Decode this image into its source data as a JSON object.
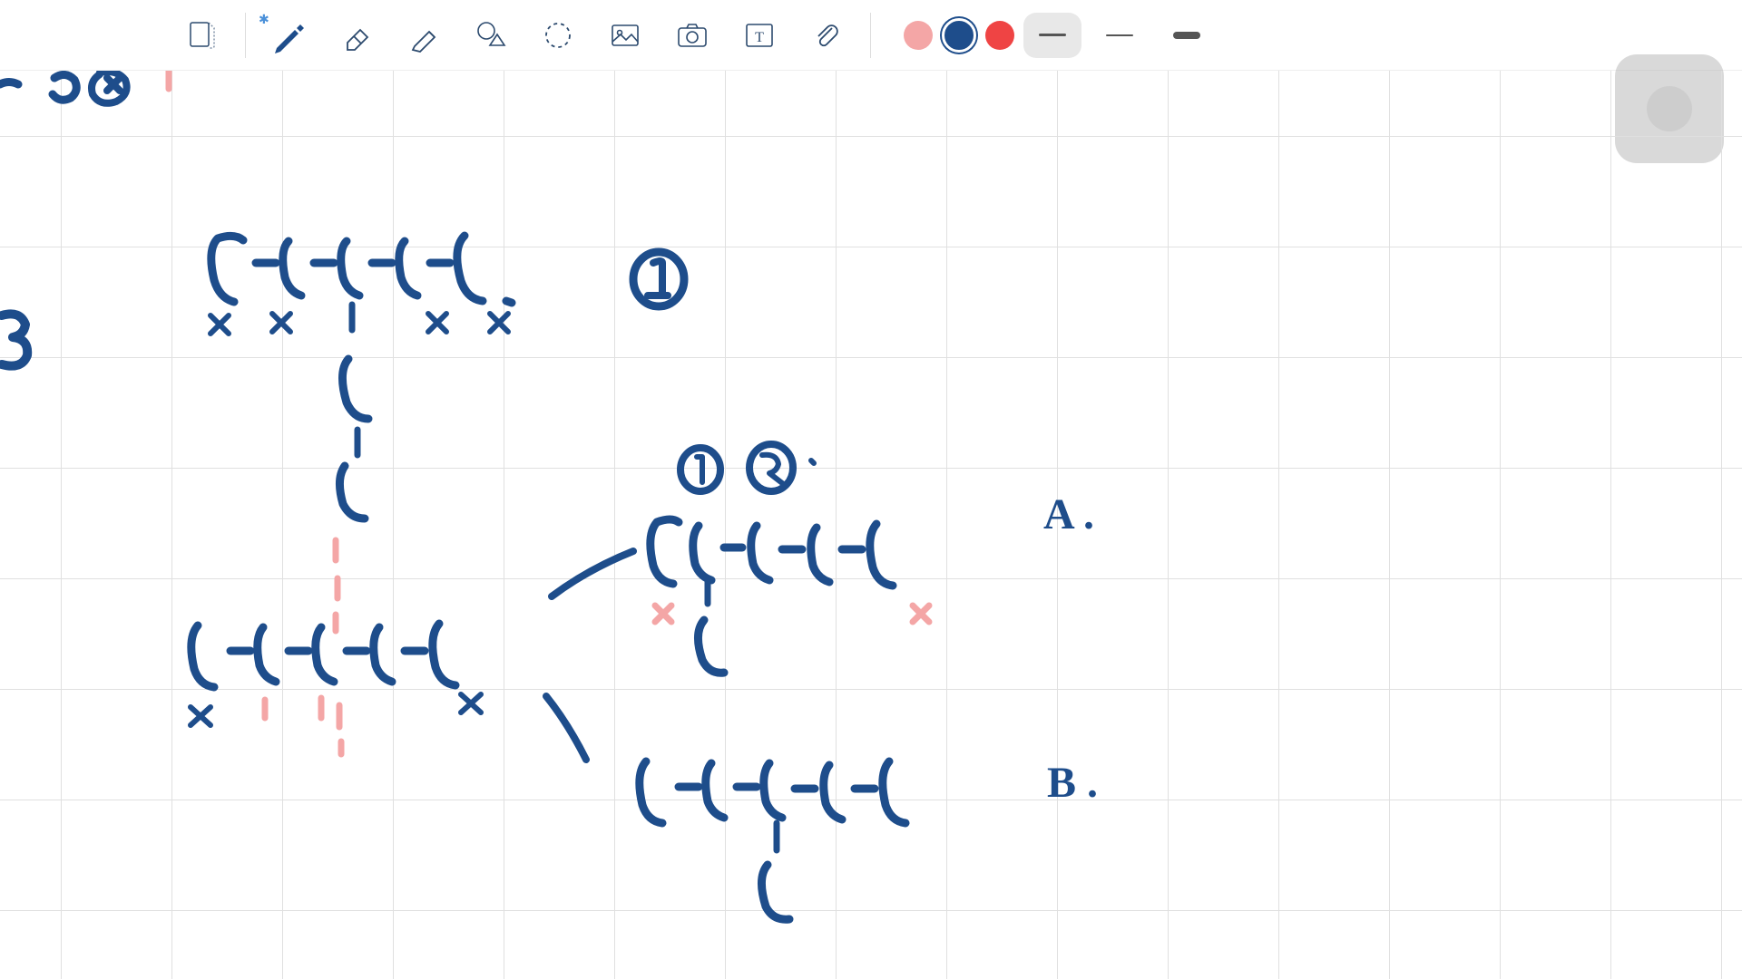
{
  "toolbar": {
    "tools": {
      "page": "page-view",
      "pen": "pen",
      "eraser": "eraser",
      "highlighter": "highlighter",
      "shapes": "shapes",
      "lasso": "lasso",
      "image": "image",
      "camera": "camera",
      "text": "text",
      "attachment": "attachment"
    },
    "colors": {
      "pink": "#f4a6a6",
      "blue": "#1e4d8b",
      "red": "#ef4444",
      "selected": "blue"
    },
    "strokes": {
      "selected": "medium",
      "options": [
        "medium",
        "thin",
        "thick"
      ]
    },
    "bluetooth": "connected"
  },
  "canvas": {
    "grid_size": 122,
    "ink_color": "#1e4d8b",
    "accent_color": "#f4a6a6",
    "labels": {
      "A": "A .",
      "B": "B ."
    },
    "annotations": {
      "circled_1_top": "①",
      "circled_1": "①",
      "circled_2": "②",
      "edge_3": "3"
    },
    "structures": [
      {
        "id": "chain-top",
        "desc": "5-carbon chain with 2-carbon branch at C3, x marks under C1 C2 C4 C5"
      },
      {
        "id": "chain-mid-left",
        "desc": "5-carbon chain, x marks under C1 C5, pink tick marks under C2 C3 C4"
      },
      {
        "id": "chain-A",
        "desc": "5-carbon chain branch down at C2, circled 1 2 above, x under C1 C5"
      },
      {
        "id": "chain-B",
        "desc": "5-carbon chain branch down at C3"
      }
    ]
  }
}
